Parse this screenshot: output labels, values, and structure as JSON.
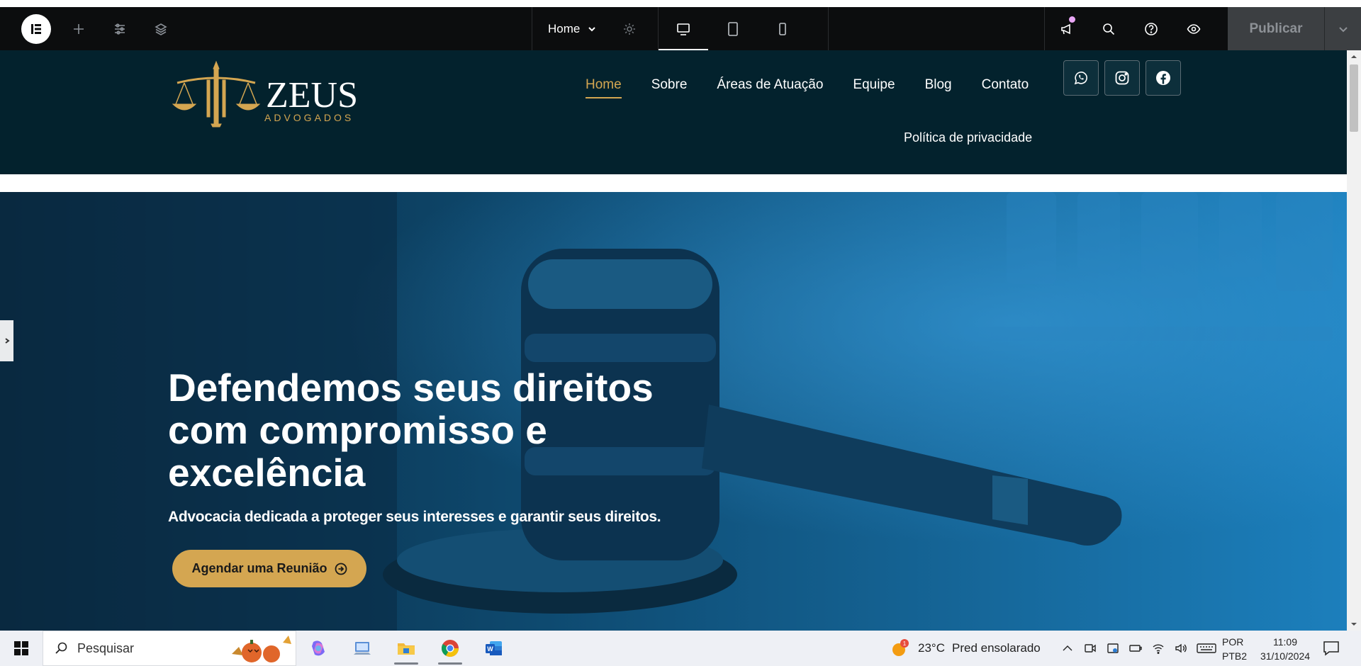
{
  "editor": {
    "page_name": "Home",
    "publish_label": "Publicar"
  },
  "site": {
    "logo_name": "ZEUS",
    "logo_tagline": "ADVOGADOS",
    "nav": [
      {
        "label": "Home",
        "active": true
      },
      {
        "label": "Sobre",
        "active": false
      },
      {
        "label": "Áreas de Atuação",
        "active": false
      },
      {
        "label": "Equipe",
        "active": false
      },
      {
        "label": "Blog",
        "active": false
      },
      {
        "label": "Contato",
        "active": false
      }
    ],
    "nav_second_row": "Política de privacidade",
    "socials": [
      "whatsapp-icon",
      "instagram-icon",
      "facebook-icon"
    ],
    "colors": {
      "header_bg": "#03222d",
      "accent_gold": "#d4a651",
      "hero_blue": "#0d3a55"
    }
  },
  "hero": {
    "title": "Defendemos seus direitos com compromisso e excelência",
    "subtitle": "Advocacia dedicada a proteger seus interesses e garantir seus direitos.",
    "cta_label": "Agendar uma Reunião"
  },
  "taskbar": {
    "search_placeholder": "Pesquisar",
    "weather_temp": "23°C",
    "weather_desc": "Pred ensolarado",
    "lang_1": "POR",
    "lang_2": "PTB2",
    "time": "11:09",
    "date": "31/10/2024"
  }
}
